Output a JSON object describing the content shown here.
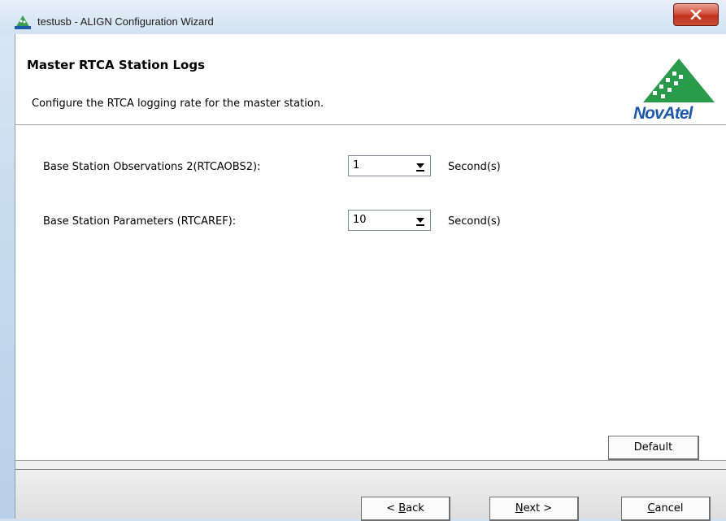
{
  "window": {
    "title": "testusb - ALIGN Configuration Wizard",
    "close_icon": "close-icon"
  },
  "header": {
    "title": "Master RTCA Station Logs",
    "description": "Configure the RTCA logging rate for the master station.",
    "logo_text": "NovAtel"
  },
  "fields": [
    {
      "label": "Base Station Observations 2(RTCAOBS2):",
      "value": "1",
      "unit": "Second(s)"
    },
    {
      "label": "Base Station Parameters (RTCAREF):",
      "value": "10",
      "unit": "Second(s)"
    }
  ],
  "buttons": {
    "default": "Default",
    "back_prefix": "< ",
    "back_mnemonic": "B",
    "back_rest": "ack",
    "next_mnemonic": "N",
    "next_rest": "ext >",
    "cancel_mnemonic": "C",
    "cancel_rest": "ancel"
  },
  "colors": {
    "close_button": "#c9432d",
    "logo_green": "#2a9b4a",
    "logo_blue": "#1d5aa8"
  }
}
